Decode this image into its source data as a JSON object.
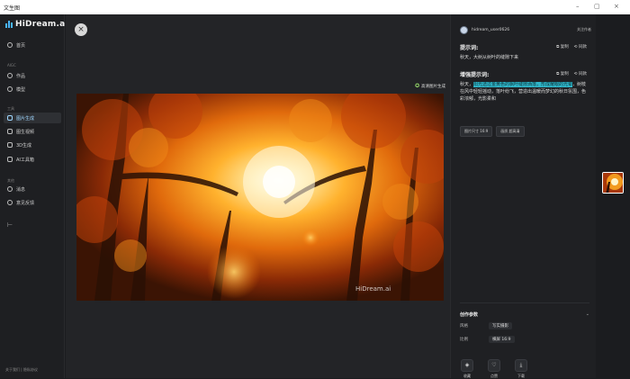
{
  "window": {
    "title": "文生图",
    "minimize": "–",
    "maximize": "▢",
    "close": "×"
  },
  "logo": {
    "text": "HiDream.ai"
  },
  "sidebar": {
    "items": [
      {
        "label": "首页",
        "icon": "home-icon"
      },
      {
        "label": "作品",
        "icon": "heart-icon"
      },
      {
        "label": "模型",
        "icon": "grid-icon"
      },
      {
        "label": "图片生成",
        "icon": "image-icon",
        "active": true
      },
      {
        "label": "图生视频",
        "icon": "film-icon"
      },
      {
        "label": "3D生成",
        "icon": "cube-icon"
      },
      {
        "label": "AI工具箱",
        "icon": "tool-icon"
      },
      {
        "label": "消息",
        "icon": "bell-icon"
      },
      {
        "label": "意见反馈",
        "icon": "feedback-icon"
      }
    ],
    "section_labels": [
      "AIGC",
      "工具",
      "其他"
    ],
    "collapse": "⊢",
    "footer": "关于我们 | 隐私协议"
  },
  "stage": {
    "close": "×",
    "watermark": "HiDream.ai",
    "hd_badge": "高清图片生成"
  },
  "panel": {
    "user": {
      "name": "hidream_user0626",
      "action": "关注作者"
    },
    "prompt": {
      "title": "提示词:",
      "copy": "复制",
      "reuse": "同款",
      "text": "秋天，大树从树叶的缝隙下来"
    },
    "enhanced": {
      "title": "增强提示词:",
      "copy": "复制",
      "reuse": "同款",
      "text_plain": "秋天，",
      "text_highlight": "阳光透过金黄色的枫叶缝隙洒落，形成耀眼的光晕",
      "text_rest": "，树枝在风中轻轻摇动，落叶纷飞，营造出温暖而梦幻的秋日氛围，色彩浓郁，光影柔和"
    },
    "chips": [
      "图片尺寸 16:9",
      "画质 超高清"
    ],
    "params": {
      "title": "创作参数",
      "rows": [
        {
          "label": "风格",
          "value": "写实摄影"
        },
        {
          "label": "比例",
          "value": "横屏 16:9"
        }
      ]
    },
    "actions": [
      {
        "label": "收藏",
        "icon": "bookmark-icon",
        "glyph": "◈"
      },
      {
        "label": "点赞",
        "icon": "like-icon",
        "glyph": "♡"
      },
      {
        "label": "下载",
        "icon": "download-icon",
        "glyph": "⤓"
      }
    ]
  },
  "colors": {
    "accent": "#49b6ff",
    "highlight": "#2fb6c9",
    "bg": "#1b1c1f"
  }
}
